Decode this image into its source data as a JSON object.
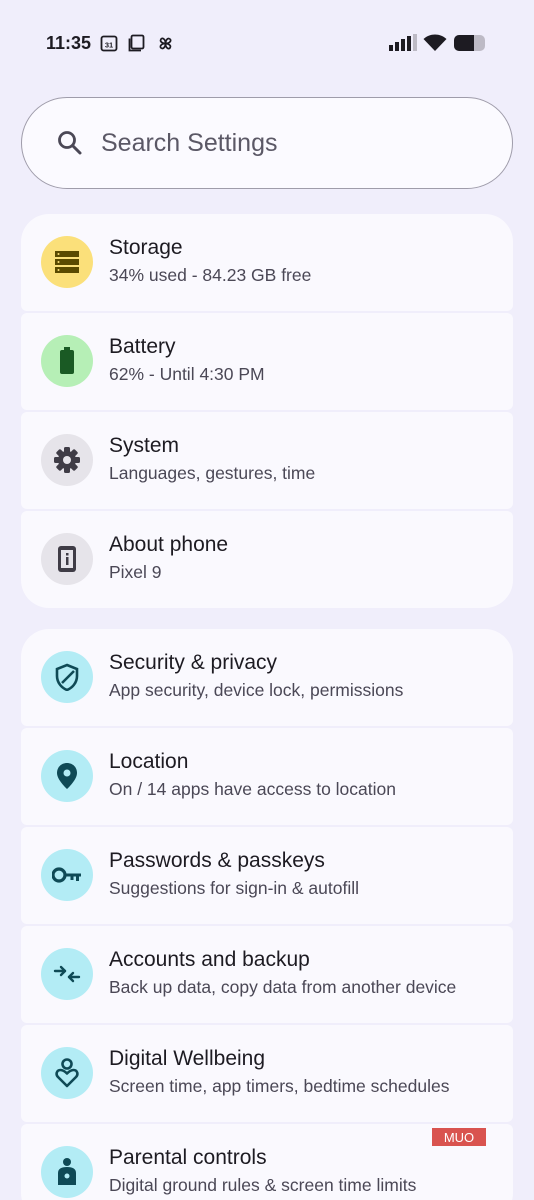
{
  "status_bar": {
    "time": "11:35",
    "calendar_day": "31"
  },
  "search": {
    "placeholder": "Search Settings"
  },
  "groups": [
    {
      "items": [
        {
          "title": "Storage",
          "subtitle": "34% used - 84.23 GB free",
          "icon": "storage-icon",
          "badge_color": "#fbe07a",
          "icon_color": "#5a4a00"
        },
        {
          "title": "Battery",
          "subtitle": "62% - Until 4:30 PM",
          "icon": "battery-icon",
          "badge_color": "#b6efb6",
          "icon_color": "#1a5a24"
        },
        {
          "title": "System",
          "subtitle": "Languages, gestures, time",
          "icon": "gear-icon",
          "badge_color": "#e6e4ea",
          "icon_color": "#3f3c46"
        },
        {
          "title": "About phone",
          "subtitle": "Pixel 9",
          "icon": "phone-info-icon",
          "badge_color": "#e6e4ea",
          "icon_color": "#3f3c46"
        }
      ]
    },
    {
      "items": [
        {
          "title": "Security & privacy",
          "subtitle": "App security, device lock, permissions",
          "icon": "shield-icon",
          "badge_color": "#b3ecf5",
          "icon_color": "#0f4a56"
        },
        {
          "title": "Location",
          "subtitle": "On / 14 apps have access to location",
          "icon": "location-pin-icon",
          "badge_color": "#b3ecf5",
          "icon_color": "#0f4a56"
        },
        {
          "title": "Passwords & passkeys",
          "subtitle": "Suggestions for sign-in & autofill",
          "icon": "key-icon",
          "badge_color": "#b3ecf5",
          "icon_color": "#0f4a56"
        },
        {
          "title": "Accounts and backup",
          "subtitle": "Back up data, copy data from another device",
          "icon": "sync-arrows-icon",
          "badge_color": "#b3ecf5",
          "icon_color": "#0f4a56"
        },
        {
          "title": "Digital Wellbeing",
          "subtitle": "Screen time, app timers, bedtime schedules",
          "icon": "wellbeing-heart-icon",
          "badge_color": "#b3ecf5",
          "icon_color": "#0f4a56"
        },
        {
          "title": "Parental controls",
          "subtitle": "Digital ground rules & screen time limits",
          "icon": "parental-icon",
          "badge_color": "#b3ecf5",
          "icon_color": "#0f4a56"
        }
      ]
    }
  ],
  "watermark": {
    "text": "MUO"
  }
}
